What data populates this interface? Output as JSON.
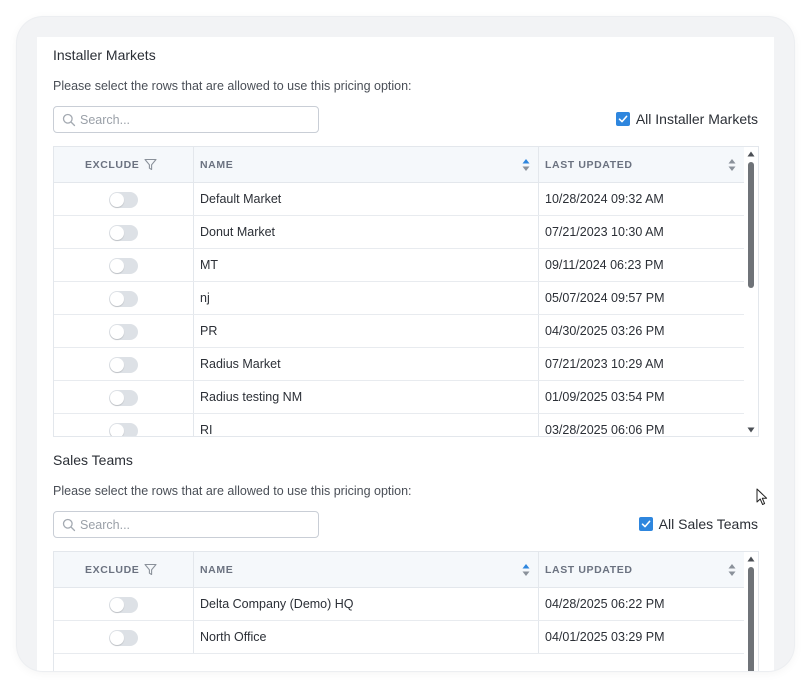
{
  "installer_markets": {
    "title": "Installer Markets",
    "description": "Please select the rows that are allowed to use this pricing option:",
    "search_placeholder": "Search...",
    "all_label": "All Installer Markets",
    "all_checked": true,
    "columns": {
      "exclude": "EXCLUDE",
      "name": "NAME",
      "last_updated": "LAST UPDATED"
    },
    "rows": [
      {
        "name": "Default Market",
        "last_updated": "10/28/2024 09:32 AM",
        "exclude": false
      },
      {
        "name": "Donut Market",
        "last_updated": "07/21/2023 10:30 AM",
        "exclude": false
      },
      {
        "name": "MT",
        "last_updated": "09/11/2024 06:23 PM",
        "exclude": false
      },
      {
        "name": "nj",
        "last_updated": "05/07/2024 09:57 PM",
        "exclude": false
      },
      {
        "name": "PR",
        "last_updated": "04/30/2025 03:26 PM",
        "exclude": false
      },
      {
        "name": "Radius Market",
        "last_updated": "07/21/2023 10:29 AM",
        "exclude": false
      },
      {
        "name": "Radius testing NM",
        "last_updated": "01/09/2025 03:54 PM",
        "exclude": false
      },
      {
        "name": "RI",
        "last_updated": "03/28/2025 06:06 PM",
        "exclude": false
      }
    ]
  },
  "sales_teams": {
    "title": "Sales Teams",
    "description": "Please select the rows that are allowed to use this pricing option:",
    "search_placeholder": "Search...",
    "all_label": "All Sales Teams",
    "all_checked": true,
    "columns": {
      "exclude": "EXCLUDE",
      "name": "NAME",
      "last_updated": "LAST UPDATED"
    },
    "rows": [
      {
        "name": "Delta Company (Demo) HQ",
        "last_updated": "04/28/2025 06:22 PM",
        "exclude": false
      },
      {
        "name": "North Office",
        "last_updated": "04/01/2025 03:29 PM",
        "exclude": false
      }
    ]
  },
  "colors": {
    "accent": "#2e86de",
    "toggle_off": "#dde1e6",
    "header_bg": "#f5f8fb"
  },
  "icons": [
    "search-icon",
    "checkbox-checked-icon",
    "filter-icon",
    "sort-icon",
    "scroll-up-icon",
    "scroll-down-icon",
    "mouse-cursor-icon"
  ]
}
